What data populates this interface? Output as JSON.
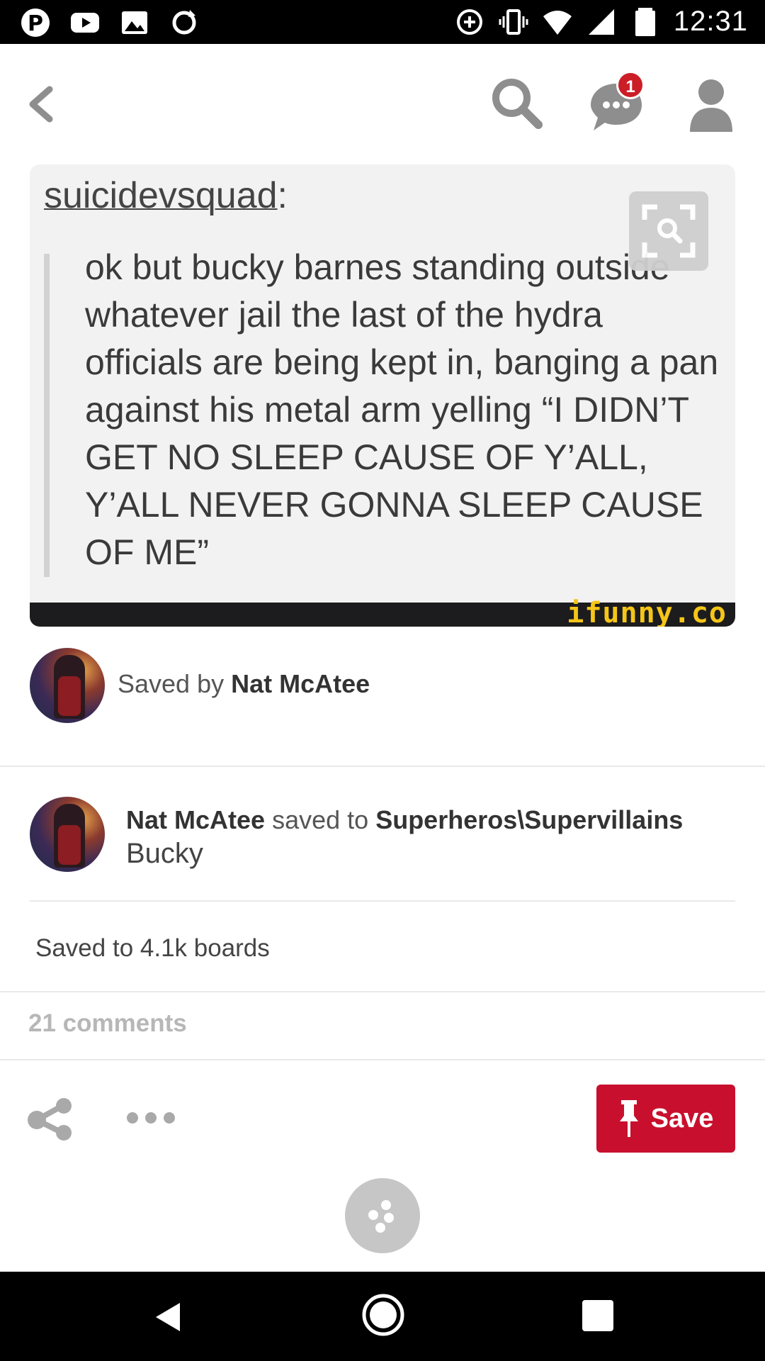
{
  "status_bar": {
    "time": "12:31",
    "left_icons": [
      "pinterest-icon",
      "youtube-icon",
      "gallery-icon",
      "sync-icon"
    ],
    "right_icons": [
      "data-saver-icon",
      "vibrate-icon",
      "wifi-icon",
      "signal-icon",
      "battery-icon"
    ]
  },
  "app_bar": {
    "back_icon": "chevron-left-icon",
    "search_icon": "search-icon",
    "messages_icon": "chat-bubble-icon",
    "messages_badge": "1",
    "profile_icon": "person-icon"
  },
  "pin": {
    "username": "suicidevsquad",
    "username_suffix": ":",
    "quote": "ok but bucky barnes standing outside whatever jail the last of the hydra officials are being kept in, banging a pan against his metal arm yelling “I DIDN’T GET NO SLEEP CAUSE OF Y’ALL, Y’ALL NEVER GONNA SLEEP CAUSE OF ME”",
    "watermark": "ifunny.co"
  },
  "saved_by": {
    "prefix": "Saved by",
    "user": "Nat McAtee"
  },
  "saved_to": {
    "user": "Nat McAtee",
    "middle": "saved to",
    "board": "Superheros\\Supervillains",
    "section": "Bucky"
  },
  "stats": {
    "boards": "Saved to 4.1k boards",
    "comments": "21 comments"
  },
  "actions": {
    "share_icon": "share-icon",
    "more_icon": "more-dots-icon",
    "save_label": "Save"
  },
  "colors": {
    "save_red": "#c8102e",
    "badge_red": "#cb1e27",
    "icon_gray": "#8e8e8e"
  }
}
